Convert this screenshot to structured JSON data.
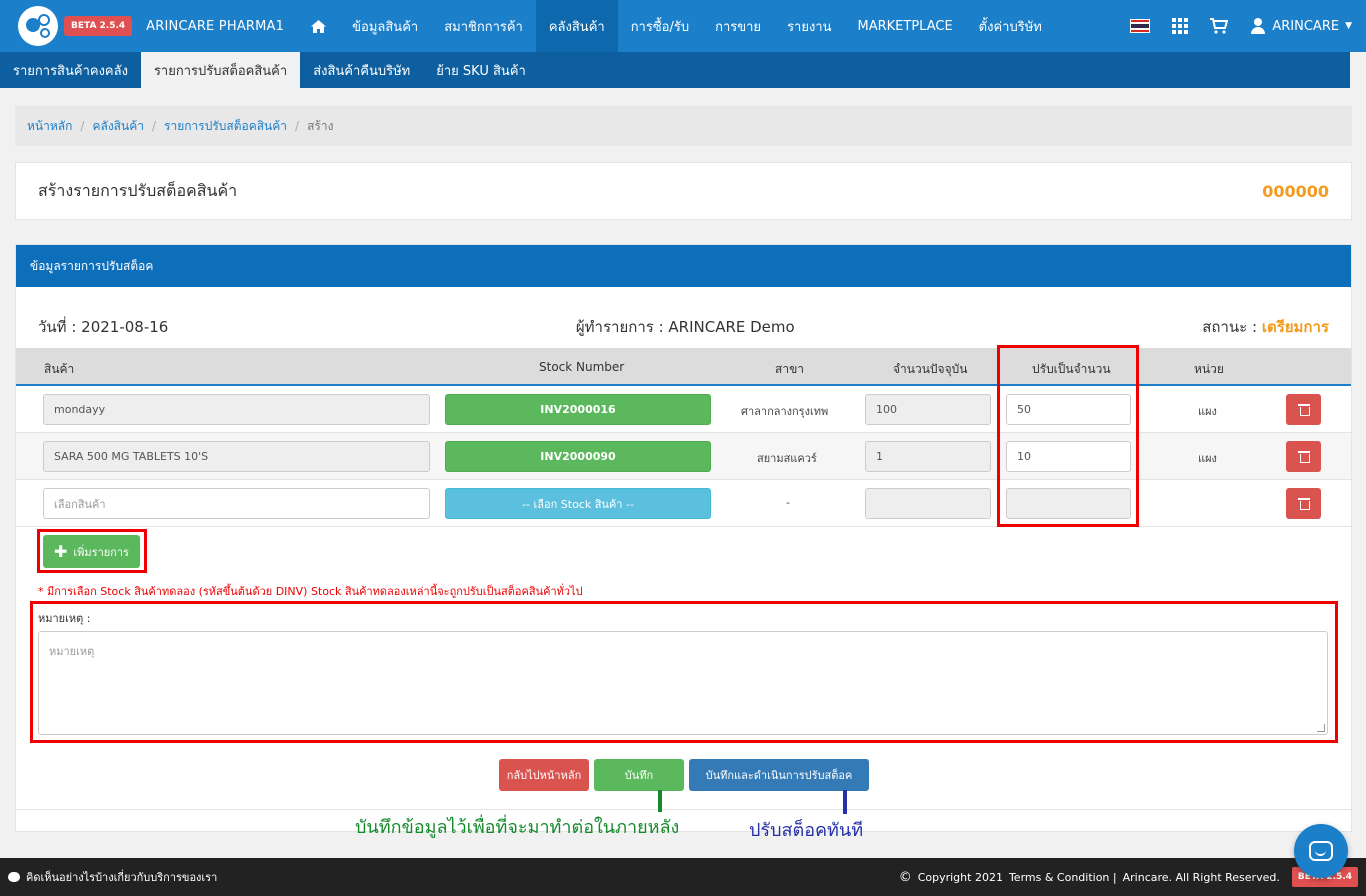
{
  "header": {
    "beta": "BETA 2.5.4",
    "brand": "ARINCARE PHARMA1",
    "nav": [
      "ข้อมูลสินค้า",
      "สมาชิกการค้า",
      "คลังสินค้า",
      "การซื้อ/รับ",
      "การขาย",
      "รายงาน",
      "MARKETPLACE",
      "ตั้งค่าบริษัท"
    ],
    "user": "ARINCARE"
  },
  "subnav": [
    "รายการสินค้าคงคลัง",
    "รายการปรับสต็อคสินค้า",
    "ส่งสินค้าคืนบริษัท",
    "ย้าย SKU สินค้า"
  ],
  "breadcrumb": [
    "หน้าหลัก",
    "คลังสินค้า",
    "รายการปรับสต็อคสินค้า",
    "สร้าง"
  ],
  "title": {
    "text": "สร้างรายการปรับสต็อคสินค้า",
    "code": "000000"
  },
  "panel": {
    "heading": "ข้อมูลรายการปรับสต็อค",
    "date": "วันที่ : 2021-08-16",
    "maker": "ผู้ทำรายการ : ARINCARE Demo",
    "status_label": "สถานะ :",
    "status_value": "เตรียมการ"
  },
  "table": {
    "headers": [
      "สินค้า",
      "Stock Number",
      "สาขา",
      "จำนวนปัจจุบัน",
      "ปรับเป็นจำนวน",
      "หน่วย"
    ],
    "rows": [
      {
        "product": "mondayy",
        "stock": "INV2000016",
        "branch": "ศาลากลางกรุงเทพ",
        "current": "100",
        "adjust": "50",
        "unit": "แผง"
      },
      {
        "product": "SARA 500 MG TABLETS 10'S",
        "stock": "INV2000090",
        "branch": "สยามสแควร์",
        "current": "1",
        "adjust": "10",
        "unit": "แผง"
      },
      {
        "product_placeholder": "เลือกสินค้า",
        "stock": "-- เลือก Stock สินค้า --",
        "branch": "-",
        "current": "",
        "adjust": "",
        "unit": ""
      }
    ]
  },
  "add_button": "เพิ่มรายการ",
  "warning": "* มีการเลือก Stock สินค้าทดลอง (รหัสขึ้นต้นด้วย DINV) Stock สินค้าทดลองเหล่านี้จะถูกปรับเป็นสต็อคสินค้าทั่วไป",
  "remark": {
    "label": "หมายเหตุ :",
    "placeholder": "หมายเหตุ"
  },
  "buttons": {
    "back": "กลับไปหน้าหลัก",
    "save": "บันทึก",
    "save_adjust": "บันทึกและดำเนินการปรับสต็อค"
  },
  "annotations": {
    "green": "บันทึกข้อมูลไว้เพื่อที่จะมาทำต่อในภายหลัง",
    "blue": "ปรับสต็อคทันที"
  },
  "footer": {
    "feedback": "คิดเห็นอย่างไรบ้างเกี่ยวกับบริการของเรา",
    "copyright": "Copyright 2021",
    "terms": "Terms & Condition |",
    "rights": "Arincare. All Right Reserved.",
    "beta": "BETA 2.5.4"
  },
  "colors": {
    "primary": "#1b7fc9",
    "status": "#f29b1d",
    "annotation_red": "#ee0000"
  }
}
